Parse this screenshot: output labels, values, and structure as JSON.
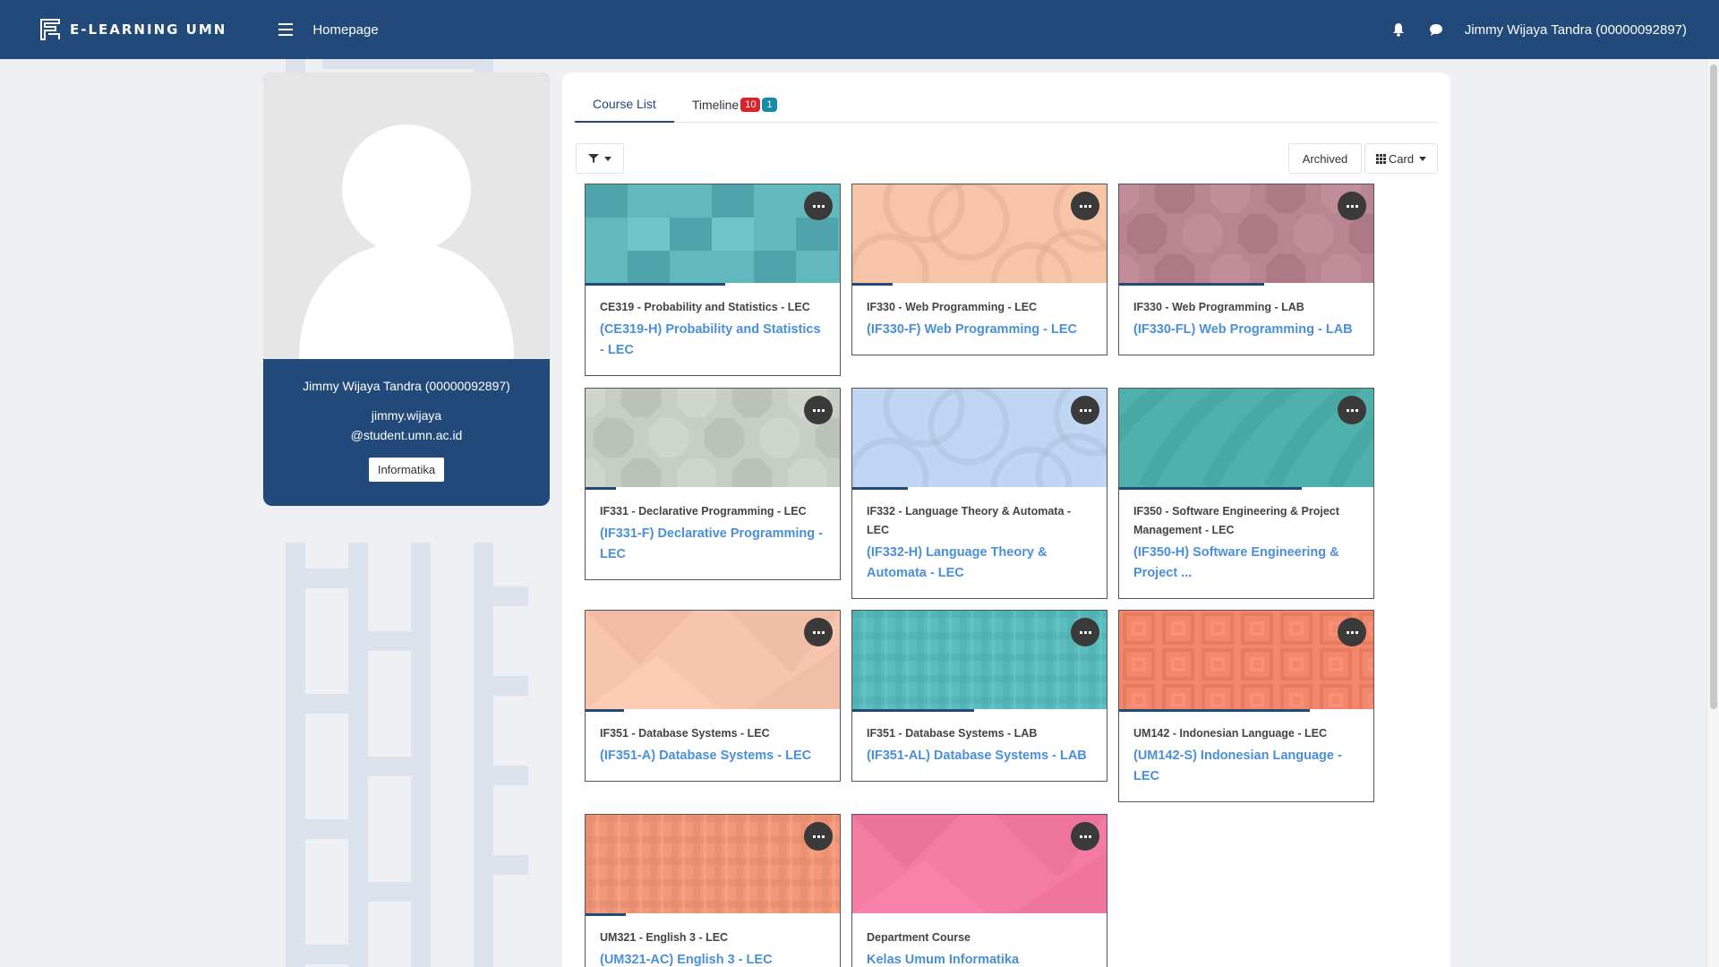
{
  "navbar": {
    "brand": "E-LEARNING UMN",
    "home_link": "Homepage",
    "user_menu": "Jimmy Wijaya Tandra (00000092897)"
  },
  "profile": {
    "name": "Jimmy Wijaya Tandra (00000092897)",
    "email_line1": "jimmy.wijaya",
    "email_line2": "@student.umn.ac.id",
    "department": "Informatika"
  },
  "tabs": {
    "course_list": "Course List",
    "timeline": "Timeline",
    "timeline_badge_red": "10",
    "timeline_badge_teal": "1"
  },
  "toolbar": {
    "archived": "Archived",
    "view_mode": "Card"
  },
  "colors": {
    "brand": "#21497a",
    "link": "#4a8fd8"
  },
  "courses": [
    {
      "code": "CE319 - Probability and Statistics - LEC",
      "title": "(CE319-H) Probability and Statistics - LEC",
      "color": "#62b8bd",
      "pattern": "squares",
      "progress": 0.55
    },
    {
      "code": "IF330 - Web Programming - LEC",
      "title": "(IF330-F) Web Programming - LEC",
      "color": "#f7c4a8",
      "pattern": "circles",
      "progress": 0.16
    },
    {
      "code": "IF330 - Web Programming - LAB",
      "title": "(IF330-FL) Web Programming - LAB",
      "color": "#b98590",
      "pattern": "octagons",
      "progress": 0.57
    },
    {
      "code": "IF331 - Declarative Programming - LEC",
      "title": "(IF331-F) Declarative Programming - LEC",
      "color": "#c7cec3",
      "pattern": "octagons",
      "progress": 0.12
    },
    {
      "code": "IF332 - Language Theory & Automata - LEC",
      "title": "(IF332-H) Language Theory & Automata - LEC",
      "color": "#c1d6f2",
      "pattern": "circles",
      "progress": 0.22
    },
    {
      "code": "IF350 - Software Engineering & Project Management - LEC",
      "title": "(IF350-H) Software Engineering & Project ...",
      "color": "#4fb0ad",
      "pattern": "waves",
      "progress": 0.72
    },
    {
      "code": "IF351 - Database Systems - LEC",
      "title": "(IF351-A) Database Systems - LEC",
      "color": "#f7c4ad",
      "pattern": "triangles",
      "progress": 0.15
    },
    {
      "code": "IF351 - Database Systems - LAB",
      "title": "(IF351-AL) Database Systems - LAB",
      "color": "#5bbdbd",
      "pattern": "plaid",
      "progress": 0.48
    },
    {
      "code": "UM142 - Indonesian Language - LEC",
      "title": "(UM142-S) Indonesian Language - LEC",
      "color": "#f2876c",
      "pattern": "concentric",
      "progress": 0.75
    },
    {
      "code": "UM321 - English 3 - LEC",
      "title": "(UM321-AC) English 3 - LEC",
      "color": "#f3997b",
      "pattern": "plaid",
      "progress": 0.16
    },
    {
      "code": "Department Course",
      "title": "Kelas Umum Informatika",
      "color": "#f47ba2",
      "pattern": "triangles",
      "progress": 0
    }
  ]
}
